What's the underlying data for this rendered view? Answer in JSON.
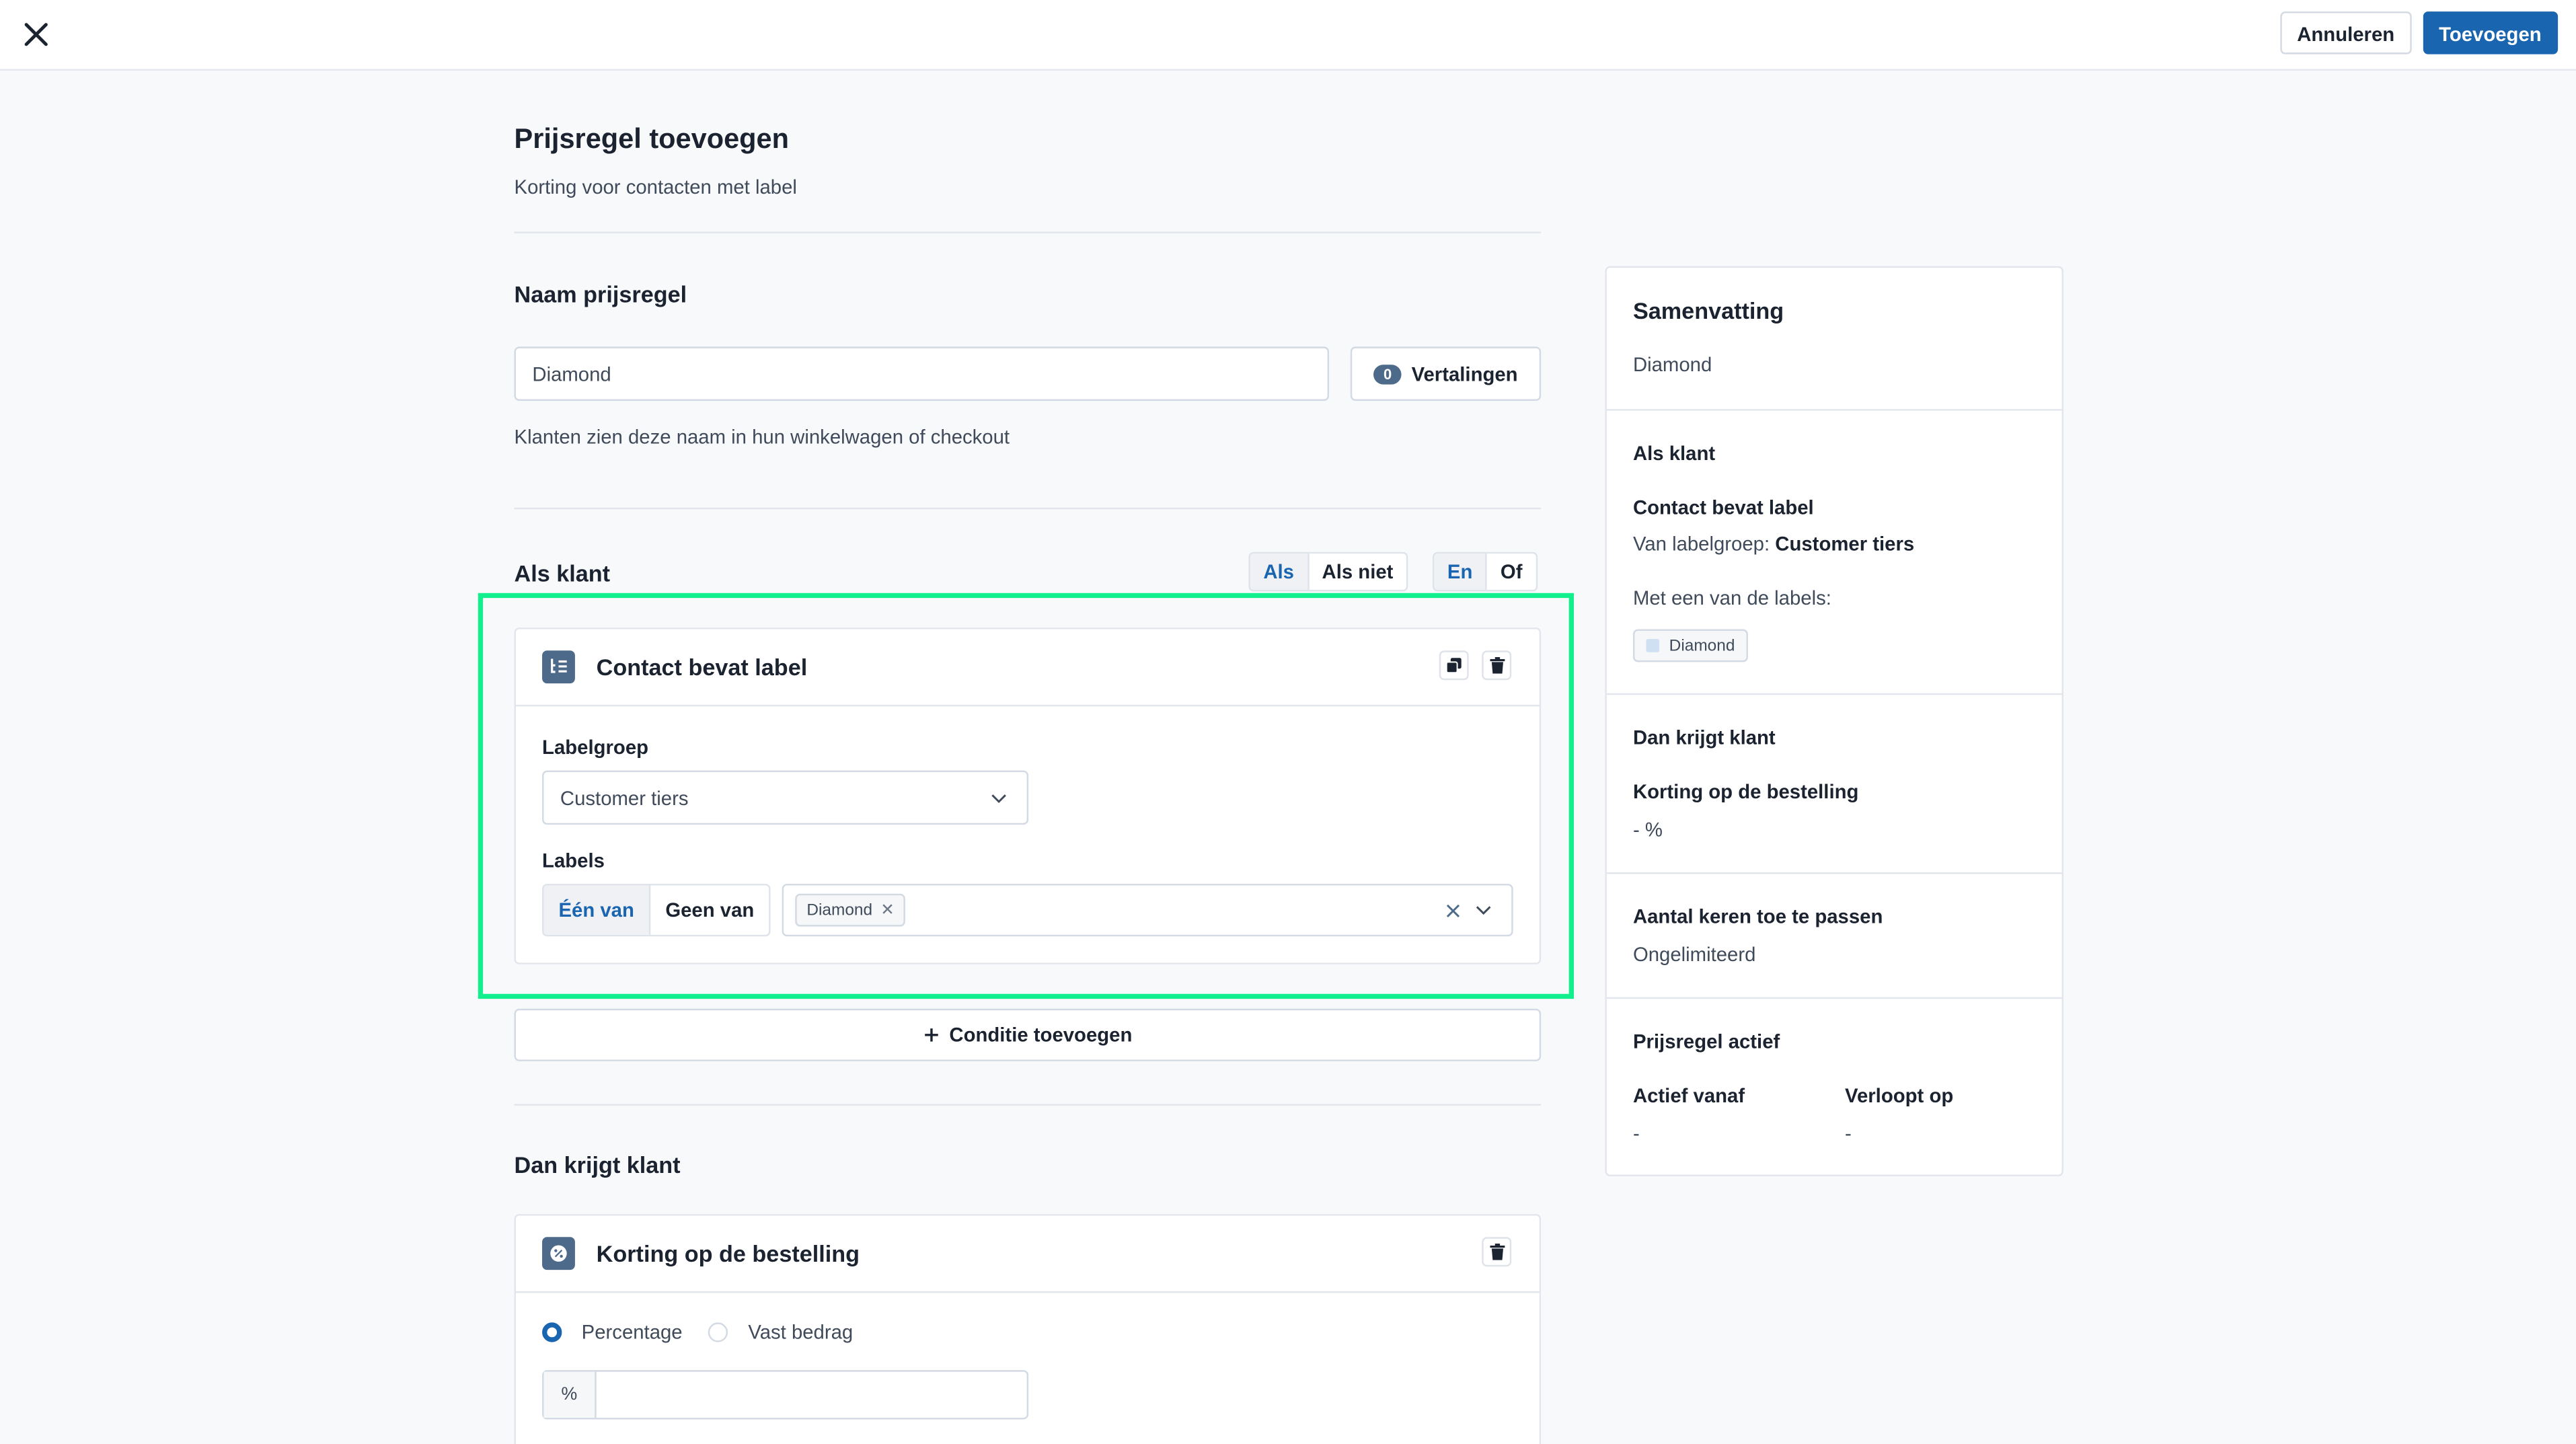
{
  "topbar": {
    "close_icon": "close-icon",
    "cancel_label": "Annuleren",
    "add_label": "Toevoegen"
  },
  "page": {
    "title": "Prijsregel toevoegen",
    "subtitle": "Korting voor contacten met label"
  },
  "name_section": {
    "title": "Naam prijsregel",
    "input_value": "Diamond",
    "translations_count": "0",
    "translations_label": "Vertalingen",
    "helper": "Klanten zien deze naam in hun winkelwagen of checkout"
  },
  "if_section": {
    "title": "Als klant",
    "mode_toggle": [
      {
        "label": "Als",
        "active": true
      },
      {
        "label": "Als niet",
        "active": false
      }
    ],
    "logic_toggle": [
      {
        "label": "En",
        "active": true
      },
      {
        "label": "Of",
        "active": false
      }
    ],
    "condition": {
      "title": "Contact bevat label",
      "icon": "label-list-icon",
      "labelgroup_label": "Labelgroep",
      "labelgroup_value": "Customer tiers",
      "labels_label": "Labels",
      "match_toggle": [
        {
          "label": "Één van",
          "active": true
        },
        {
          "label": "Geen van",
          "active": false
        }
      ],
      "selected_tags": [
        "Diamond"
      ]
    },
    "add_condition_label": "Conditie toevoegen"
  },
  "then_section": {
    "title": "Dan krijgt klant",
    "discount": {
      "title": "Korting op de bestelling",
      "icon": "discount-badge-icon",
      "type_options": [
        {
          "label": "Percentage",
          "selected": true
        },
        {
          "label": "Vast bedrag",
          "selected": false
        }
      ],
      "prefix": "%",
      "value": ""
    }
  },
  "summary": {
    "title": "Samenvatting",
    "name": "Diamond",
    "if_heading": "Als klant",
    "condition_title": "Contact bevat label",
    "labelgroup_prefix": "Van labelgroep:",
    "labelgroup_value": "Customer tiers",
    "labels_prefix": "Met een van de labels:",
    "labels": [
      "Diamond"
    ],
    "label_color": "#cfe0f3",
    "then_heading": "Dan krijgt klant",
    "discount_title": "Korting op de bestelling",
    "discount_value": "- %",
    "uses_heading": "Aantal keren toe te passen",
    "uses_value": "Ongelimiteerd",
    "active_heading": "Prijsregel actief",
    "active_from_label": "Actief vanaf",
    "active_from_value": "-",
    "expires_label": "Verloopt op",
    "expires_value": "-"
  },
  "colors": {
    "primary": "#1a65b0",
    "highlight": "#12f08e",
    "icon_bg": "#4d6a8a"
  }
}
